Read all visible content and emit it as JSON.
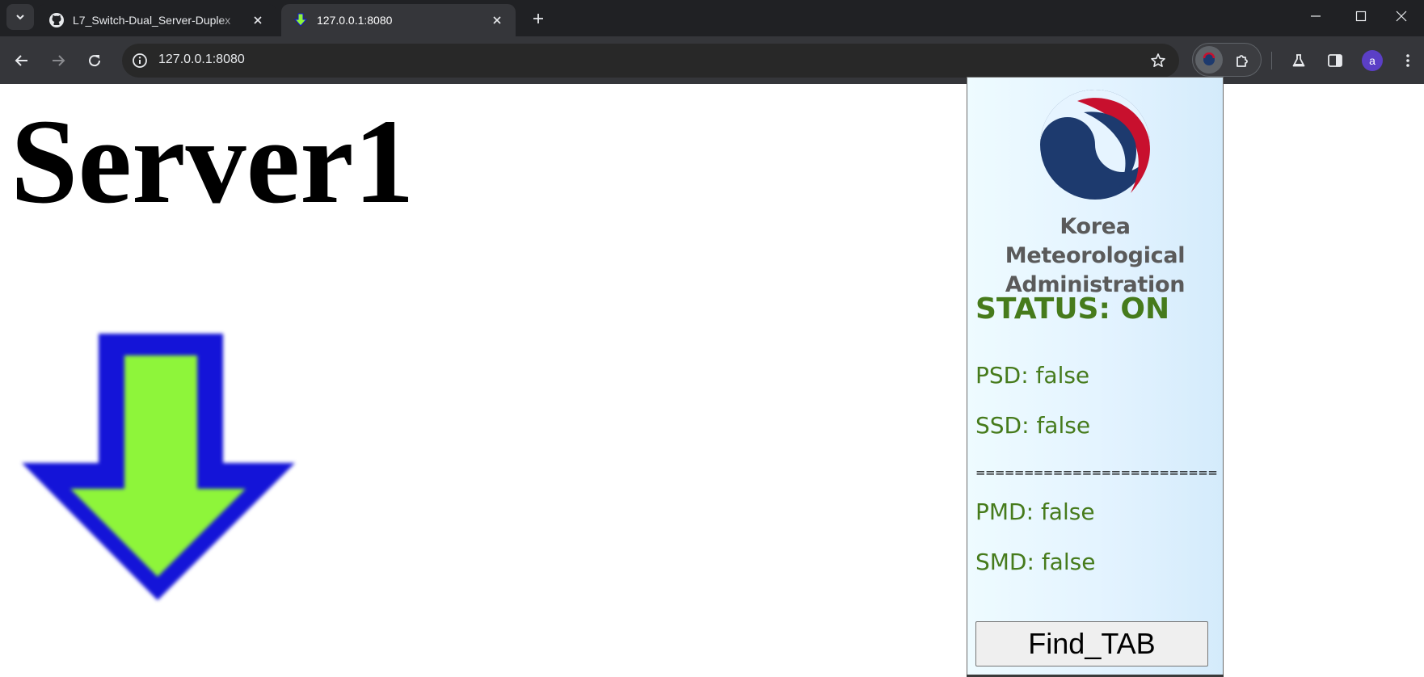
{
  "browser": {
    "tabs": [
      {
        "title": "L7_Switch-Dual_Server-Duplex",
        "favicon": "github-icon",
        "active": false
      },
      {
        "title": "127.0.0.1:8080",
        "favicon": "download-arrow-icon",
        "active": true
      }
    ],
    "address": "127.0.0.1:8080",
    "profile_initial": "a"
  },
  "page": {
    "heading": "Server1",
    "image": "download-arrow-icon",
    "arrow_colors": {
      "fill": "#8ef53a",
      "outline": "#1414d8"
    }
  },
  "extension_popup": {
    "org_name": "Korea Meteorological Administration",
    "status": "STATUS: ON",
    "psd": "PSD: false",
    "ssd": "SSD: false",
    "divider": "============================",
    "pmd": "PMD: false",
    "smd": "SMD: false",
    "button_label": "Find_TAB",
    "colors": {
      "status_green": "#467b1c",
      "logo_red": "#c8102e",
      "logo_blue": "#1d3a6e"
    }
  }
}
